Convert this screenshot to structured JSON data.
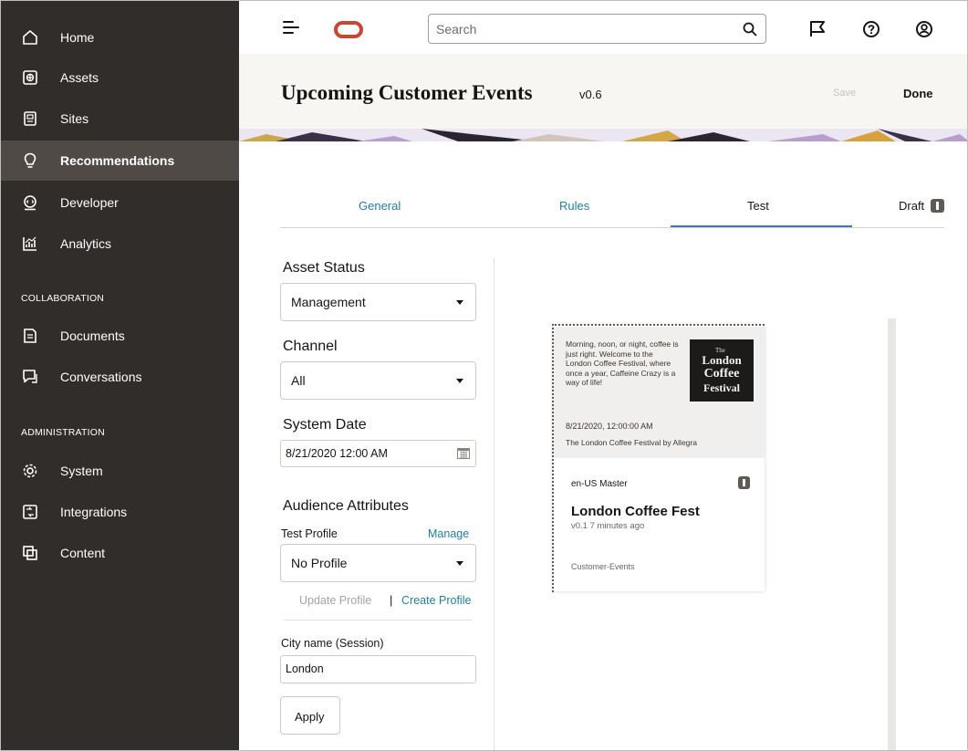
{
  "sidebar": {
    "items": [
      {
        "label": "Home",
        "icon": "home-icon"
      },
      {
        "label": "Assets",
        "icon": "assets-icon"
      },
      {
        "label": "Sites",
        "icon": "sites-icon"
      },
      {
        "label": "Recommendations",
        "icon": "lightbulb-icon",
        "active": true
      },
      {
        "label": "Developer",
        "icon": "developer-icon"
      },
      {
        "label": "Analytics",
        "icon": "analytics-icon"
      }
    ],
    "collaboration_title": "COLLABORATION",
    "collaboration_items": [
      {
        "label": "Documents",
        "icon": "documents-icon"
      },
      {
        "label": "Conversations",
        "icon": "conversations-icon"
      }
    ],
    "administration_title": "ADMINISTRATION",
    "administration_items": [
      {
        "label": "System",
        "icon": "gear-icon"
      },
      {
        "label": "Integrations",
        "icon": "integrations-icon"
      },
      {
        "label": "Content",
        "icon": "content-icon"
      }
    ]
  },
  "topbar": {
    "search_placeholder": "Search",
    "icons": [
      "menu-icon",
      "oracle-logo",
      "search-icon",
      "flag-icon",
      "help-icon",
      "user-icon"
    ]
  },
  "header": {
    "title": "Upcoming Customer Events",
    "version": "v0.6",
    "save_label": "Save",
    "done_label": "Done"
  },
  "tabs": {
    "general": "General",
    "rules": "Rules",
    "test": "Test",
    "active": "Test",
    "draft_label": "Draft"
  },
  "form": {
    "asset_status_label": "Asset Status",
    "asset_status_value": "Management",
    "channel_label": "Channel",
    "channel_value": "All",
    "system_date_label": "System Date",
    "system_date_value": "8/21/2020 12:00 AM",
    "audience_label": "Audience Attributes",
    "test_profile_label": "Test Profile",
    "manage_label": "Manage",
    "profile_value": "No Profile",
    "update_profile_label": "Update Profile",
    "separator": "|",
    "create_profile_label": "Create Profile",
    "city_label": "City name (Session)",
    "city_value": "London",
    "apply_label": "Apply"
  },
  "card": {
    "thumb_text": "Morning, noon, or night, coffee is just right. Welcome to the London Coffee Festival, where once a year, Caffeine Crazy is a way of life!",
    "thumb_date": "8/21/2020, 12:00:00 AM",
    "thumb_caption": "The London Coffee Festival by Allegra",
    "logo_the": "The",
    "logo_london": "London",
    "logo_coffee": "Coffee",
    "logo_festival": "Festival",
    "language": "en-US  Master",
    "title": "London Coffee Fest",
    "meta": "v0.1   7 minutes ago",
    "collection": "Customer-Events"
  },
  "colors": {
    "sidebar_bg": "#312d2a",
    "sidebar_active": "#4f4a45",
    "link": "#227e9e",
    "tab_underline": "#3b77c2",
    "oracle_red": "#c74634"
  }
}
